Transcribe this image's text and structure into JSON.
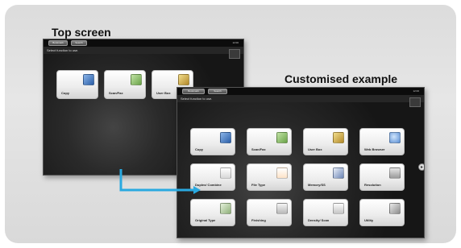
{
  "captions": {
    "top_screen": "Top screen",
    "customised_example": "Customised example"
  },
  "screen_a": {
    "tab1": "Bookmark",
    "tab2": "Search",
    "prompt": "Select function to use.",
    "clock": "12:00",
    "tiles": [
      {
        "label": "Copy",
        "icon": "copy-icon",
        "color": "blue"
      },
      {
        "label": "Scan/Fax",
        "icon": "scan-fax-icon",
        "color": "green"
      },
      {
        "label": "User Box",
        "icon": "user-box-icon",
        "color": "gold"
      }
    ]
  },
  "screen_b": {
    "tab1": "Bookmark",
    "tab2": "Search",
    "prompt": "Select function to use.",
    "clock": "12:00",
    "tiles": [
      {
        "label": "Copy",
        "icon": "copy-icon"
      },
      {
        "label": "Scan/Fax",
        "icon": "scan-fax-icon"
      },
      {
        "label": "User Box",
        "icon": "user-box-icon"
      },
      {
        "label": "Web Browser",
        "icon": "globe-icon"
      },
      {
        "label": "Duplex/ Combine",
        "icon": "duplex-icon"
      },
      {
        "label": "File Type",
        "icon": "file-type-icon"
      },
      {
        "label": "Memory/SS",
        "icon": "usb-memory-icon"
      },
      {
        "label": "Resolution",
        "icon": "resolution-icon"
      },
      {
        "label": "Original Type",
        "icon": "original-type-icon"
      },
      {
        "label": "Finishing",
        "icon": "finishing-icon"
      },
      {
        "label": "Density/ Scan",
        "icon": "density-scan-icon"
      },
      {
        "label": "Utility",
        "icon": "utility-icon"
      }
    ]
  },
  "colors": {
    "arrow": "#29a9e0",
    "panel": "#dedede",
    "screen": "#1e1e1e"
  }
}
